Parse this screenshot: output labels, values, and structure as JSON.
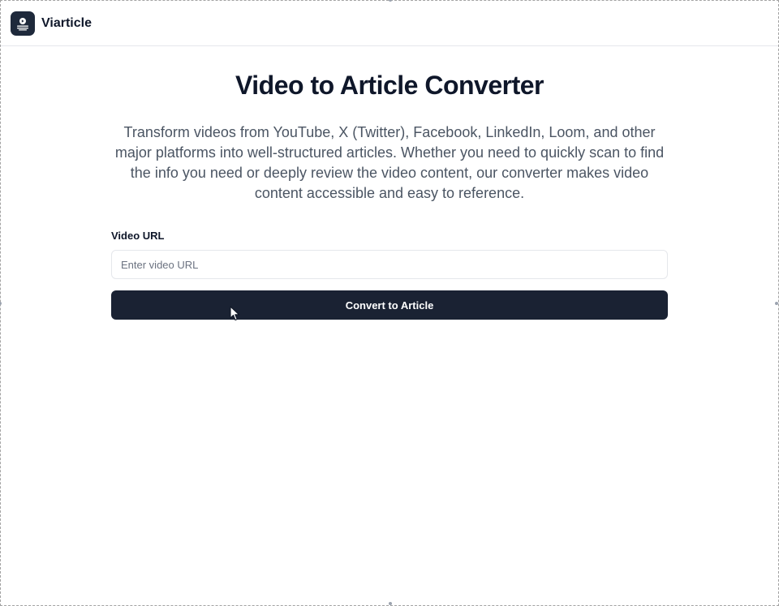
{
  "header": {
    "logo_icon": "video-article-icon",
    "brand": "Viarticle"
  },
  "main": {
    "title": "Video to Article Converter",
    "description": "Transform videos from YouTube, X (Twitter), Facebook, LinkedIn, Loom, and other major platforms into well-structured articles. Whether you need to quickly scan to find the info you need or deeply review the video content, our converter makes video content accessible and easy to reference."
  },
  "form": {
    "url_label": "Video URL",
    "url_value": "",
    "url_placeholder": "Enter video URL",
    "submit_label": "Convert to Article"
  },
  "colors": {
    "primary": "#1a2233",
    "text": "#0f172a",
    "muted": "#4b5563",
    "border": "#e5e7eb"
  }
}
